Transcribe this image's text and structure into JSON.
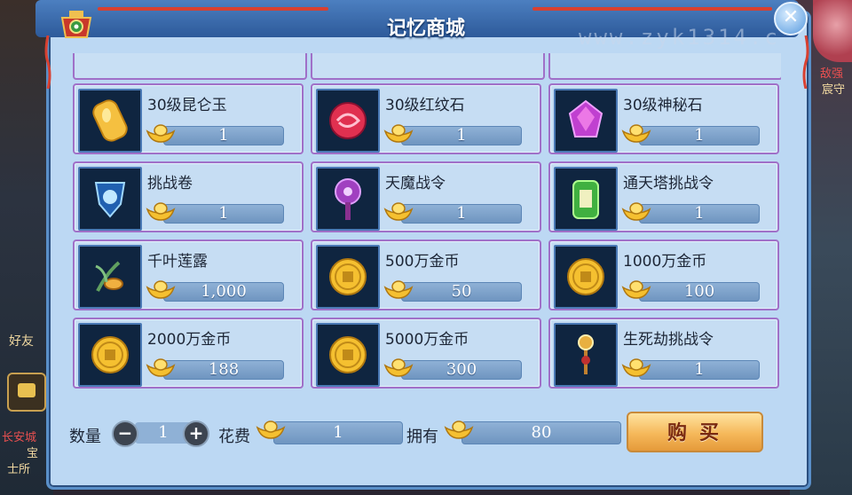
{
  "window": {
    "title": "记忆商城",
    "close_label": "✕",
    "watermark": "www.zyk1314.c"
  },
  "background": {
    "left_texts": [
      "好友",
      "长安城",
      "宝",
      "士所"
    ],
    "right_texts": [
      "敌强",
      "宸守"
    ]
  },
  "items": [
    {
      "name": "30级昆仑玉",
      "price": "1",
      "icon": "kunlun-jade-icon"
    },
    {
      "name": "30级红纹石",
      "price": "1",
      "icon": "red-pattern-stone-icon"
    },
    {
      "name": "30级神秘石",
      "price": "1",
      "icon": "mystery-stone-icon"
    },
    {
      "name": "挑战卷",
      "price": "1",
      "icon": "challenge-scroll-icon"
    },
    {
      "name": "天魔战令",
      "price": "1",
      "icon": "demon-war-token-icon"
    },
    {
      "name": "通天塔挑战令",
      "price": "1",
      "icon": "tower-challenge-token-icon"
    },
    {
      "name": "千叶莲露",
      "price": "1,000",
      "icon": "lotus-dew-icon"
    },
    {
      "name": "500万金币",
      "price": "50",
      "icon": "gold-coin-icon"
    },
    {
      "name": "1000万金币",
      "price": "100",
      "icon": "gold-coin-icon"
    },
    {
      "name": "2000万金币",
      "price": "188",
      "icon": "gold-coin-icon"
    },
    {
      "name": "5000万金币",
      "price": "300",
      "icon": "gold-coin-icon"
    },
    {
      "name": "生死劫挑战令",
      "price": "1",
      "icon": "life-death-token-icon"
    }
  ],
  "purchase": {
    "quantity_label": "数量",
    "quantity_value": "1",
    "minus_label": "−",
    "plus_label": "+",
    "cost_label": "花费",
    "cost_value": "1",
    "owned_label": "拥有",
    "owned_value": "80",
    "buy_label": "购买"
  },
  "colors": {
    "panel_bg": "#bcd8f3",
    "card_border": "#a070c8",
    "title_bar": "#2d5a9a",
    "buy_button": "#f5b85a"
  }
}
